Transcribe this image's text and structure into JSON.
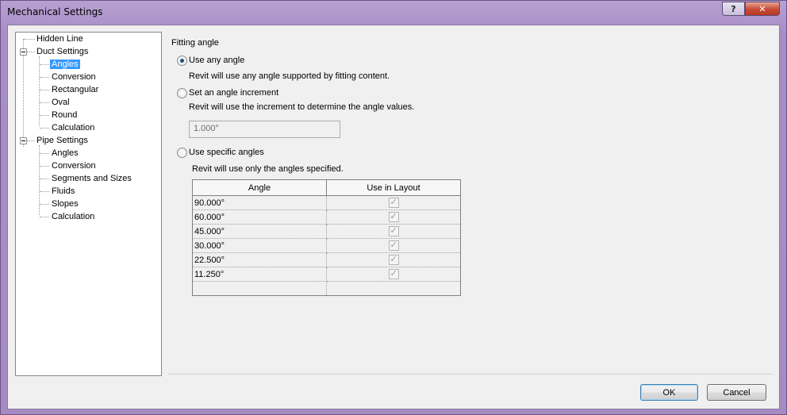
{
  "window": {
    "title": "Mechanical Settings",
    "help_label": "?",
    "close_label": "✕"
  },
  "tree": {
    "hidden_line": "Hidden Line",
    "duct_settings": "Duct Settings",
    "duct_children": [
      "Angles",
      "Conversion",
      "Rectangular",
      "Oval",
      "Round",
      "Calculation"
    ],
    "pipe_settings": "Pipe Settings",
    "pipe_children": [
      "Angles",
      "Conversion",
      "Segments and Sizes",
      "Fluids",
      "Slopes",
      "Calculation"
    ]
  },
  "panel": {
    "section_title": "Fitting angle",
    "opt_any": "Use any angle",
    "opt_any_desc": "Revit will use any angle supported by fitting content.",
    "opt_increment": "Set an angle increment",
    "opt_increment_desc": "Revit will use the increment to determine the angle values.",
    "increment_value": "1.000°",
    "opt_specific": "Use specific angles",
    "opt_specific_desc": "Revit will use only the angles specified.",
    "table": {
      "headers": [
        "Angle",
        "Use in Layout"
      ],
      "rows": [
        "90.000°",
        "60.000°",
        "45.000°",
        "30.000°",
        "22.500°",
        "11.250°"
      ]
    }
  },
  "buttons": {
    "ok": "OK",
    "cancel": "Cancel"
  }
}
